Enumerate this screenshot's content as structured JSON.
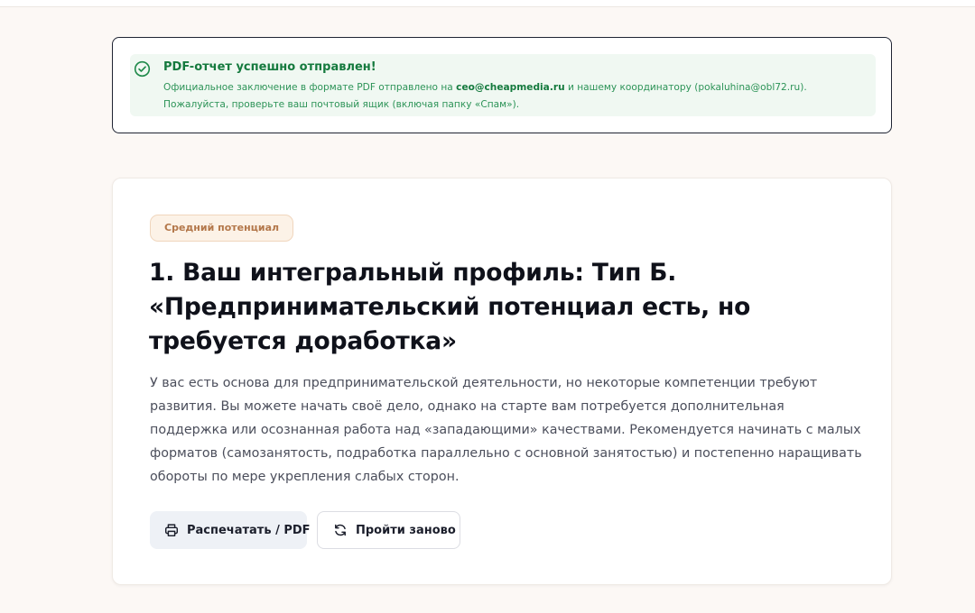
{
  "notice": {
    "title": "PDF-отчет успешно отправлен!",
    "body_prefix": "Официальное заключение в формате PDF отправлено на ",
    "email_primary": "ceo@cheapmedia.ru",
    "body_middle": " и нашему координатору (pokaluhina@obl72.ru). Пожалуйста, проверьте ваш почтовый ящик (включая папку «Спам»).",
    "icon": "check-circle-icon",
    "color": "#157a3e"
  },
  "result": {
    "badge": "Средний потенциал",
    "title": "1. Ваш интегральный профиль: Тип Б. «Предпринимательский потенциал есть, но требуется доработка»",
    "description": "У вас есть основа для предпринимательской деятельности, но некоторые компетенции требуют развития. Вы можете начать своё дело, однако на старте вам потребуется дополнительная поддержка или осознанная работа над «западающими» качествами. Рекомендуется начинать с малых форматов (самозанятость, подработка параллельно с основной занятостью) и постепенно наращивать обороты по мере укрепления слабых сторон."
  },
  "actions": {
    "print_label": "Распечатать / PDF",
    "print_icon": "printer-icon",
    "retry_label": "Пройти заново",
    "retry_icon": "refresh-icon"
  }
}
